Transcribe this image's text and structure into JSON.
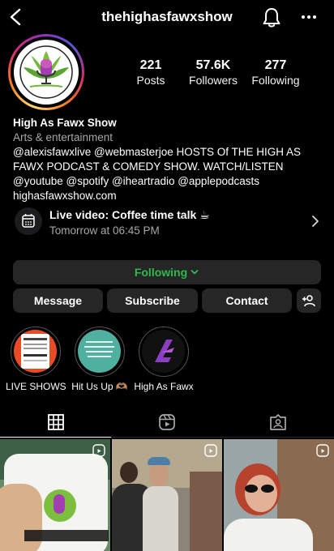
{
  "header": {
    "username": "thehighasfawxshow",
    "back_icon": "chevron-left-icon",
    "bell_icon": "bell-icon",
    "more_icon": "more-horizontal-icon"
  },
  "profile": {
    "stats": [
      {
        "num": "221",
        "label": "Posts"
      },
      {
        "num": "57.6K",
        "label": "Followers"
      },
      {
        "num": "277",
        "label": "Following"
      }
    ],
    "name": "High As Fawx Show",
    "category": "Arts & entertainment",
    "bio_lines": [
      "@alexisfawxlive @webmasterjoe HOSTS Of THE HIGH AS",
      "FAWX PODCAST & COMEDY SHOW.  WATCH/LISTEN",
      "@youtube @spotify @iheartradio @applepodcasts"
    ],
    "link": "highasfawxshow.com"
  },
  "event": {
    "title": "Live video: Coffee time talk ☕",
    "subtitle": "Tomorrow at 06:45 PM",
    "icon": "calendar-icon"
  },
  "buttons": {
    "following": "Following",
    "message": "Message",
    "subscribe": "Subscribe",
    "contact": "Contact",
    "add_user_icon": "add-user-icon"
  },
  "highlights": [
    {
      "label": "LIVE SHOWS"
    },
    {
      "label": "Hit Us Up 🫶🏽"
    },
    {
      "label": "High As Fawx"
    }
  ],
  "tabs": [
    "grid-icon",
    "reels-icon",
    "tagged-icon"
  ],
  "colors": {
    "background": "#000000",
    "button": "#262626",
    "following_green": "#2fb84f",
    "secondary_text": "#a8a8a8"
  }
}
